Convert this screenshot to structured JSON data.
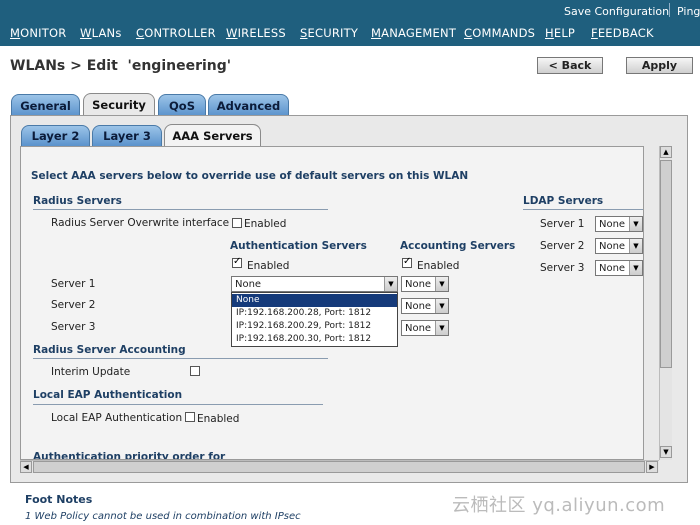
{
  "header": {
    "save_configuration": "Save Configuration",
    "ping": "Ping",
    "nav": [
      {
        "label": "MONITOR",
        "u": "M",
        "rest": "ONITOR"
      },
      {
        "label": "WLANs",
        "u": "W",
        "rest": "LANs"
      },
      {
        "label": "CONTROLLER",
        "u": "C",
        "rest": "ONTROLLER"
      },
      {
        "label": "WIRELESS",
        "u": "W",
        "rest": "IRELESS"
      },
      {
        "label": "SECURITY",
        "u": "S",
        "rest": "ECURITY"
      },
      {
        "label": "MANAGEMENT",
        "u": "M",
        "rest": "ANAGEMENT"
      },
      {
        "label": "COMMANDS",
        "u": "C",
        "rest": "OMMANDS"
      },
      {
        "label": "HELP",
        "u": "H",
        "rest": "ELP"
      },
      {
        "label": "FEEDBACK",
        "u": "F",
        "rest": "EEDBACK"
      }
    ]
  },
  "page": {
    "title": "WLANs > Edit  'engineering'",
    "back_label": "< Back",
    "apply_label": "Apply"
  },
  "tabs": [
    "General",
    "Security",
    "QoS",
    "Advanced"
  ],
  "subtabs": [
    "Layer 2",
    "Layer 3",
    "AAA Servers"
  ],
  "aaa": {
    "intro": "Select AAA servers below to override use of default servers on this WLAN",
    "radius_heading": "Radius Servers",
    "overwrite_label": "Radius Server Overwrite interface",
    "enabled": "Enabled",
    "auth_heading": "Authentication Servers",
    "acct_heading": "Accounting Servers",
    "server_labels": [
      "Server 1",
      "Server 2",
      "Server 3"
    ],
    "auth_server1_value": "None",
    "acct_values": [
      "None",
      "None",
      "None"
    ],
    "dropdown_options": [
      "None",
      "IP:192.168.200.28, Port: 1812",
      "IP:192.168.200.29, Port: 1812",
      "IP:192.168.200.30, Port: 1812"
    ],
    "accounting_heading": "Radius Server Accounting",
    "interim_label": "Interim Update",
    "local_eap_heading": "Local EAP Authentication",
    "local_eap_label": "Local EAP Authentication",
    "priority_heading": "Authentication priority order for",
    "ldap_heading": "LDAP Servers",
    "ldap_labels": [
      "Server 1",
      "Server 2",
      "Server 3"
    ],
    "ldap_values": [
      "None",
      "None",
      "None"
    ]
  },
  "footer": {
    "title": "Foot Notes",
    "note1": "1 Web Policy cannot be used in combination with IPsec",
    "watermark": "云栖社区 yq.aliyun.com"
  }
}
